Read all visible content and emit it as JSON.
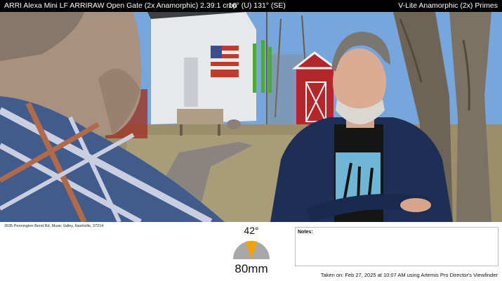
{
  "header": {
    "camera_format": "ARRI Alexa Mini LF ARRIRAW Open Gate (2x Anamorphic) 2.39:1 crop",
    "orientation": "16° (U) 131° (SE)",
    "lens_set": "V-Lite Anamorphic (2x) Primes"
  },
  "location": {
    "address": "2635 Pennington Bend Rd, Music Valley, Nashville, 37214"
  },
  "lens": {
    "angle_label": "42°",
    "focal_length": "80mm",
    "gauge_colors": {
      "fov_wedge": "#f4a300",
      "base": "#a8a8a8"
    }
  },
  "notes": {
    "label": "Notes:",
    "value": ""
  },
  "footer": {
    "taken": "Taken on: Feb 27, 2025 at 10:07 AM using Artemis Pro Director's Viewfinder"
  }
}
